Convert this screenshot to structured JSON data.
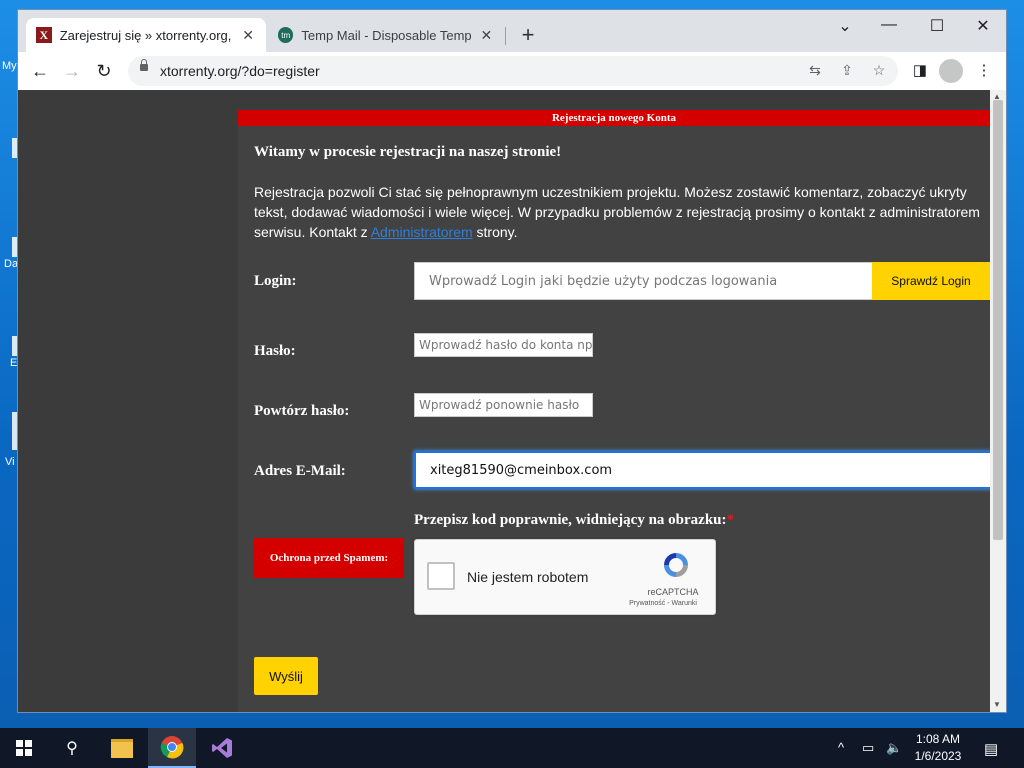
{
  "browser": {
    "tabs": [
      {
        "title": "Zarejestruj się » xtorrenty.org, PC",
        "favicon": "X",
        "active": true
      },
      {
        "title": "Temp Mail - Disposable Temporary",
        "favicon": "tm",
        "active": false
      }
    ],
    "new_tab_icon": "plus-icon",
    "url": "xtorrenty.org/?do=register"
  },
  "page": {
    "header": "Rejestracja nowego Konta",
    "welcome": "Witamy w procesie rejestracji na naszej stronie!",
    "intro_text": "Rejestracja pozwoli Ci stać się pełnoprawnym uczestnikiem projektu. Możesz zostawić komentarz, zobaczyć ukryty tekst, dodawać wiadomości i wiele więcej. W przypadku problemów z rejestracją prosimy o kontakt z administratorem serwisu. Kontakt z ",
    "intro_link": "Administratorem",
    "intro_end": " strony.",
    "form": {
      "login_label": "Login:",
      "login_placeholder": "Wprowadź Login jaki będzie użyty podczas logowania",
      "check_login_button": "Sprawdź Login",
      "password_label": "Hasło:",
      "password_placeholder": "Wprowadź hasło do konta np",
      "password_repeat_label": "Powtórz hasło:",
      "password_repeat_placeholder": "Wprowadź ponownie hasło",
      "email_label": "Adres E-Mail:",
      "email_value": "xiteg81590@cmeinbox.com",
      "captcha_title": "Przepisz kod poprawnie, widniejący na obrazku:",
      "captcha_required": "*",
      "spam_label": "Ochrona przed Spamem:",
      "recaptcha_text": "Nie jestem robotem",
      "recaptcha_brand": "reCAPTCHA",
      "recaptcha_links": "Prywatność - Warunki",
      "submit_button": "Wyślij"
    }
  },
  "desktop": {
    "labels": [
      "My",
      "Da",
      "E",
      "Vi"
    ]
  },
  "taskbar": {
    "time": "1:08 AM",
    "date": "1/6/2023"
  },
  "colors": {
    "header_red": "#d40000",
    "panel_bg": "#424242",
    "button_yellow": "#ffd200",
    "link_blue": "#2f7fd8"
  }
}
